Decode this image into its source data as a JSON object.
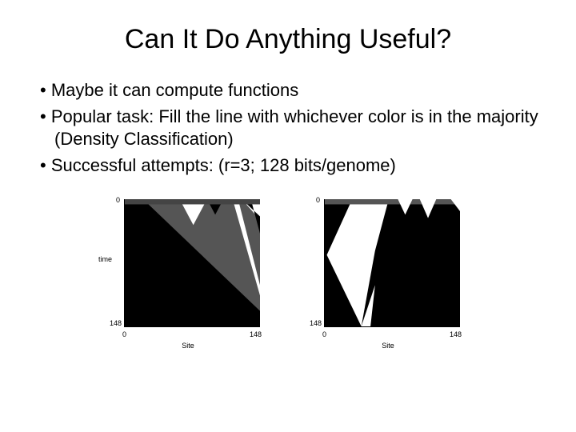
{
  "title": "Can It Do Anything Useful?",
  "bullets": [
    "Maybe it can compute functions",
    "Popular task: Fill the line with whichever color is in the majority (Density Classification)",
    "Successful attempts: (r=3; 128 bits/genome)"
  ],
  "chart_data": [
    {
      "type": "heatmap",
      "title": "",
      "xlabel": "Site",
      "ylabel": "time",
      "xlim": [
        0,
        148
      ],
      "ylim": [
        0,
        148
      ],
      "xticks": [
        0,
        148
      ],
      "yticks": [
        0,
        148
      ],
      "description": "Cellular automaton spacetime diagram, majority black; large black triangular region grows from left converging to all-black, thin white wedges from top-right."
    },
    {
      "type": "heatmap",
      "title": "",
      "xlabel": "Site",
      "ylabel": "",
      "xlim": [
        0,
        148
      ],
      "ylim": [
        0,
        148
      ],
      "xticks": [
        0,
        148
      ],
      "yticks": [
        0,
        148
      ],
      "description": "Cellular automaton spacetime diagram, mixed initial; white and black triangular domains; right half converges to black, left shows white wedge shrinking."
    }
  ]
}
